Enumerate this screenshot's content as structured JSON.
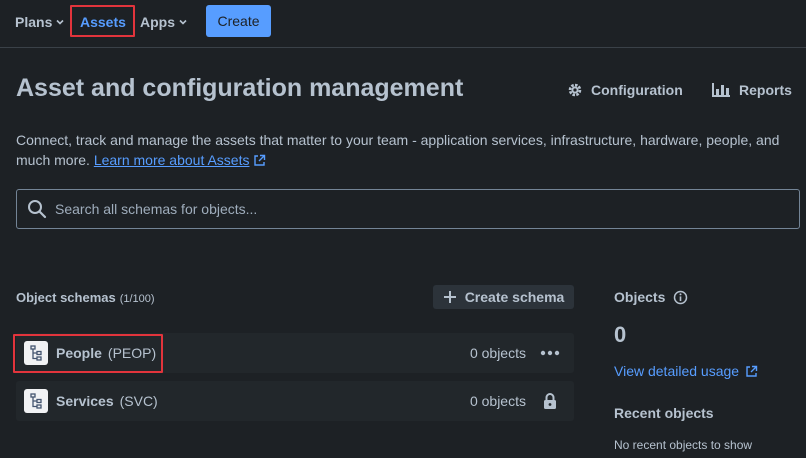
{
  "nav": {
    "plans": "Plans",
    "assets": "Assets",
    "apps": "Apps",
    "create": "Create"
  },
  "header": {
    "title": "Asset and configuration management",
    "configuration": "Configuration",
    "reports": "Reports"
  },
  "description": {
    "text": "Connect, track and manage the assets that matter to your team - application services, infrastructure, hardware, people, and much more. ",
    "link": "Learn more about Assets"
  },
  "search": {
    "placeholder": "Search all schemas for objects..."
  },
  "schemas": {
    "label": "Object schemas",
    "count": "(1/100)",
    "create_label": "Create schema",
    "rows": [
      {
        "name": "People",
        "key": "(PEOP)",
        "objects": "0 objects",
        "action_icon": "more-icon"
      },
      {
        "name": "Services",
        "key": "(SVC)",
        "objects": "0 objects",
        "action_icon": "lock-icon"
      }
    ]
  },
  "sidebar": {
    "objects_title": "Objects",
    "objects_count": "0",
    "usage_link": "View detailed usage",
    "recent_title": "Recent objects",
    "recent_empty": "No recent objects to show"
  },
  "colors": {
    "background": "#1d2125",
    "accent": "#579dff",
    "highlight": "#e2343c",
    "row": "#22272b"
  }
}
